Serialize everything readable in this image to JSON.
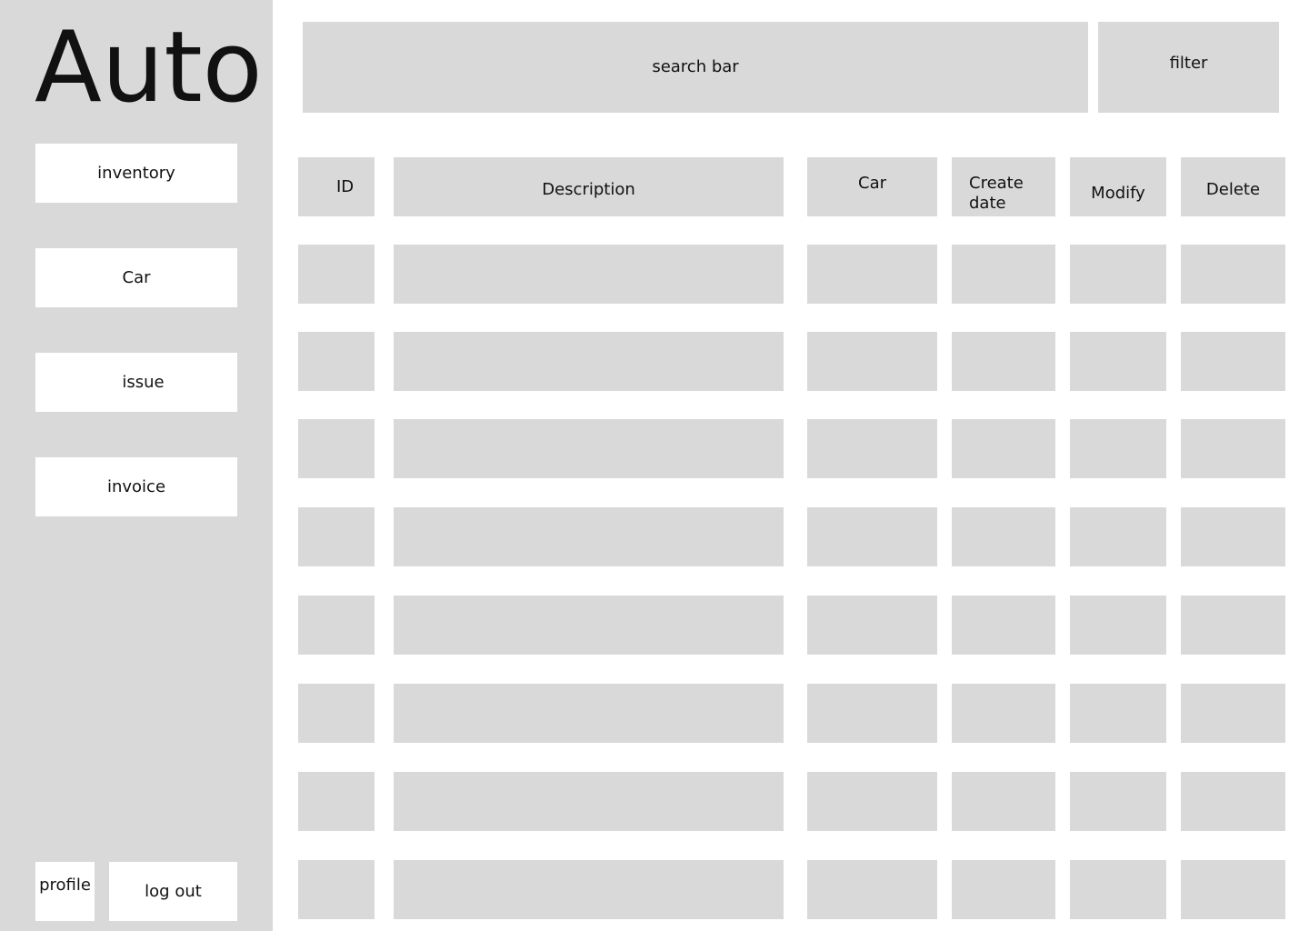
{
  "app": {
    "title": "Auto"
  },
  "sidebar": {
    "items": [
      {
        "label": "inventory"
      },
      {
        "label": "Car"
      },
      {
        "label": "issue"
      },
      {
        "label": "invoice"
      }
    ],
    "profile_label": "profile",
    "logout_label": "log out"
  },
  "toolbar": {
    "search_placeholder": "search bar",
    "filter_label": "filter"
  },
  "table": {
    "columns": [
      "ID",
      "Description",
      "Car",
      "Create date",
      "Modify",
      "Delete"
    ],
    "rows": [
      [
        "",
        "",
        "",
        "",
        "",
        ""
      ],
      [
        "",
        "",
        "",
        "",
        "",
        ""
      ],
      [
        "",
        "",
        "",
        "",
        "",
        ""
      ],
      [
        "",
        "",
        "",
        "",
        "",
        ""
      ],
      [
        "",
        "",
        "",
        "",
        "",
        ""
      ],
      [
        "",
        "",
        "",
        "",
        "",
        ""
      ],
      [
        "",
        "",
        "",
        "",
        "",
        ""
      ],
      [
        "",
        "",
        "",
        "",
        "",
        ""
      ]
    ]
  },
  "colors": {
    "sidebar_background": "#d9d9d9",
    "placeholder_background": "#d9d9d9",
    "button_background": "#ffffff",
    "text": "#111111"
  }
}
